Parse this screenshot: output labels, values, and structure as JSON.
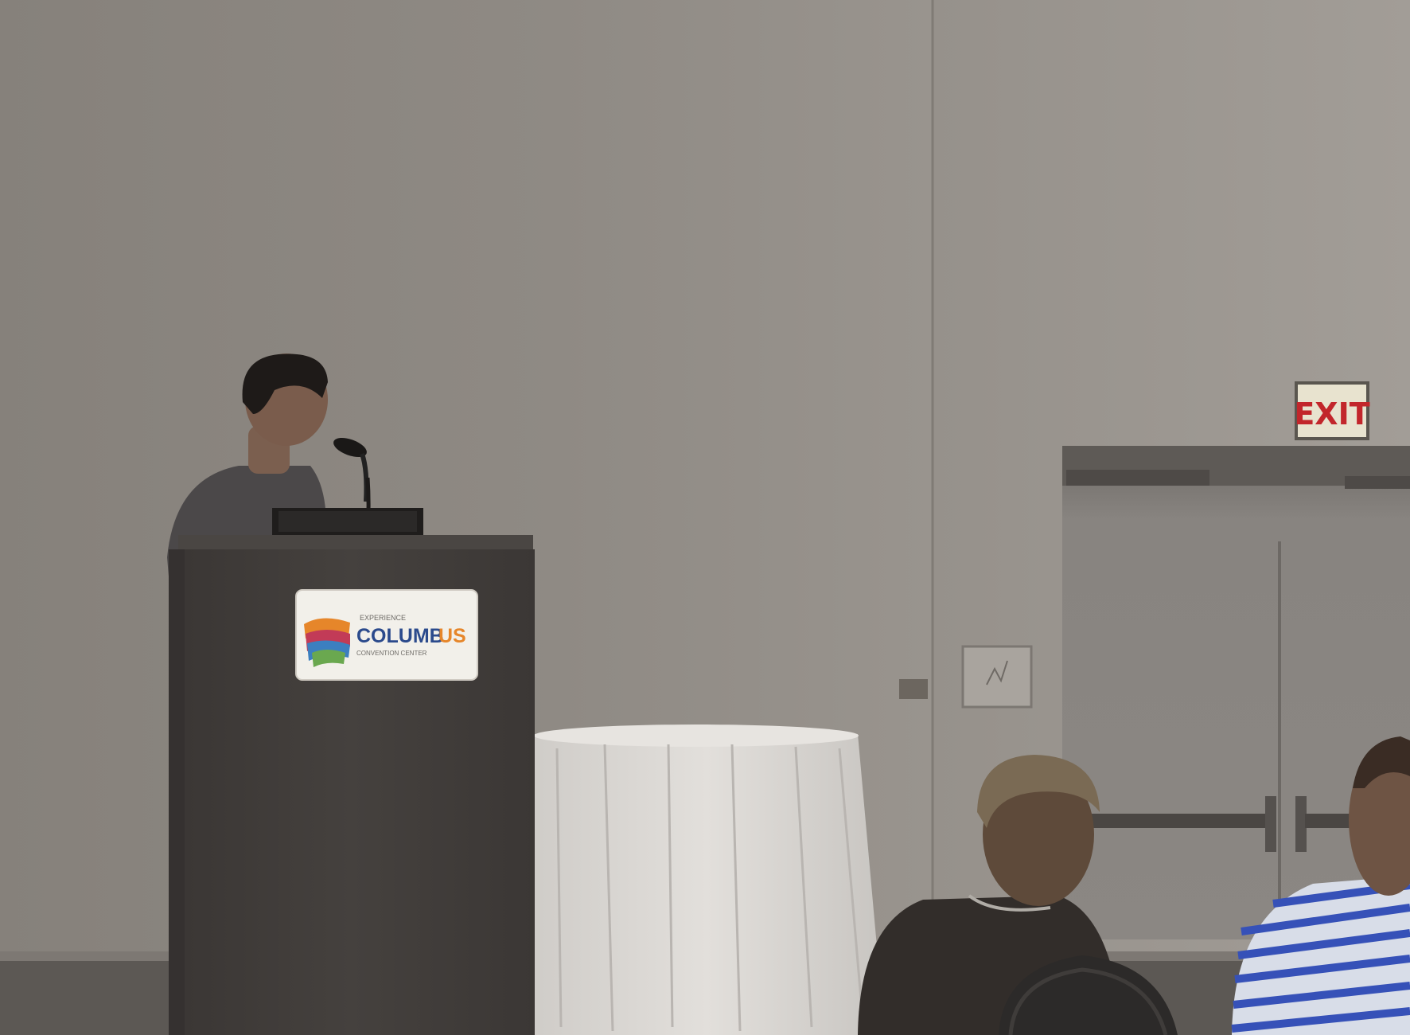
{
  "signs": {
    "exit": "EXIT"
  },
  "podium_logo": {
    "small_top": "EXPERIENCE",
    "main_left": "COLUMB",
    "main_right": "US",
    "sub": "CONVENTION CENTER"
  },
  "colors": {
    "wall": "#8d8882",
    "wall_right": "#9a958f",
    "podium": "#403c3a",
    "tablecloth": "#d9d6d2",
    "exit_red": "#c2262b",
    "exit_bg": "#e8e3cf",
    "logo_blue": "#2b4a8c",
    "logo_orange": "#e6862a",
    "shirt_stripe": "#3651b8"
  }
}
